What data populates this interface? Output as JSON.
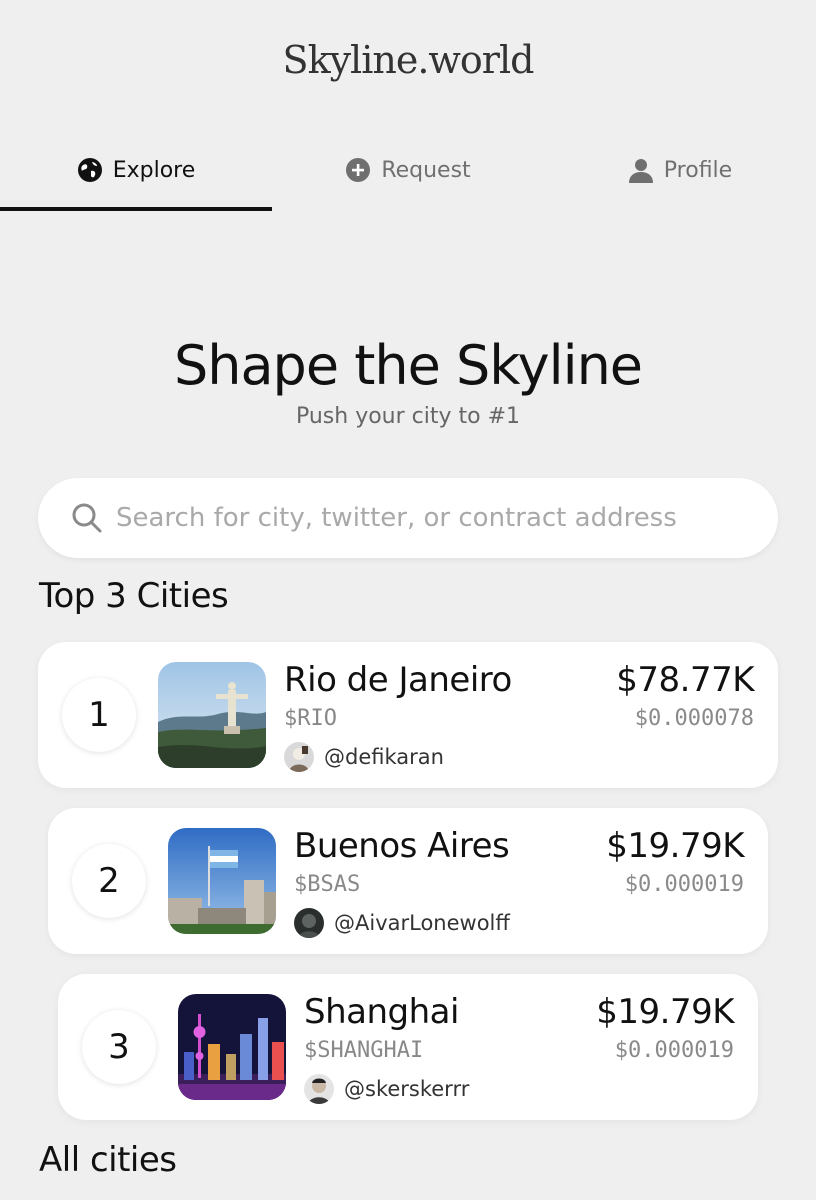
{
  "brand": "Skyline.world",
  "tabs": [
    {
      "label": "Explore",
      "icon": "globe-icon",
      "active": true
    },
    {
      "label": "Request",
      "icon": "plus-circle-icon",
      "active": false
    },
    {
      "label": "Profile",
      "icon": "user-icon",
      "active": false
    }
  ],
  "hero": {
    "title": "Shape the Skyline",
    "subtitle": "Push your city to #1"
  },
  "search": {
    "placeholder": "Search for city, twitter, or contract address",
    "value": ""
  },
  "top_section_title": "Top 3 Cities",
  "cities": [
    {
      "rank": "1",
      "name": "Rio de Janeiro",
      "ticker": "$RIO",
      "owner": "@defikaran",
      "market_cap": "$78.77K",
      "price": "$0.000078"
    },
    {
      "rank": "2",
      "name": "Buenos Aires",
      "ticker": "$BSAS",
      "owner": "@AivarLonewolff",
      "market_cap": "$19.79K",
      "price": "$0.000019"
    },
    {
      "rank": "3",
      "name": "Shanghai",
      "ticker": "$SHANGHAI",
      "owner": "@skerskerrr",
      "market_cap": "$19.79K",
      "price": "$0.000019"
    }
  ],
  "all_section_title": "All cities",
  "colors": {
    "background": "#efefef",
    "card": "#ffffff",
    "text": "#111111",
    "muted": "#888888",
    "active_underline": "#111111"
  }
}
